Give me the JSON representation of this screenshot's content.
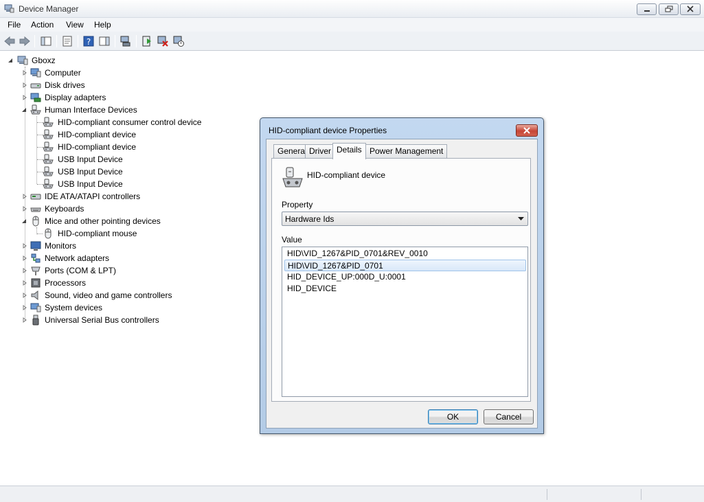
{
  "window": {
    "title": "Device Manager",
    "icon": "device-manager-icon"
  },
  "menu": [
    "File",
    "Action",
    "View",
    "Help"
  ],
  "toolbar": {
    "icons": [
      "back-arrow-icon",
      "forward-arrow-icon",
      "console-tree-icon",
      "properties-icon",
      "help-icon",
      "action-pane-icon",
      "update-driver-icon",
      "scan-hardware-icon",
      "uninstall-icon",
      "disable-icon"
    ]
  },
  "tree": {
    "root": "Gboxz",
    "categories": [
      {
        "label": "Computer",
        "icon": "computer-icon",
        "expanded": false
      },
      {
        "label": "Disk drives",
        "icon": "disk-drive-icon",
        "expanded": false
      },
      {
        "label": "Display adapters",
        "icon": "display-adapter-icon",
        "expanded": false
      },
      {
        "label": "Human Interface Devices",
        "icon": "hid-icon",
        "expanded": true,
        "children": [
          "HID-compliant consumer control device",
          "HID-compliant device",
          "HID-compliant device",
          "USB Input Device",
          "USB Input Device",
          "USB Input Device"
        ]
      },
      {
        "label": "IDE ATA/ATAPI controllers",
        "icon": "ide-controller-icon",
        "expanded": false
      },
      {
        "label": "Keyboards",
        "icon": "keyboard-icon",
        "expanded": false
      },
      {
        "label": "Mice and other pointing devices",
        "icon": "mouse-icon",
        "expanded": true,
        "children": [
          "HID-compliant mouse"
        ]
      },
      {
        "label": "Monitors",
        "icon": "monitor-icon",
        "expanded": false
      },
      {
        "label": "Network adapters",
        "icon": "network-adapter-icon",
        "expanded": false
      },
      {
        "label": "Ports (COM & LPT)",
        "icon": "port-icon",
        "expanded": false
      },
      {
        "label": "Processors",
        "icon": "processor-icon",
        "expanded": false
      },
      {
        "label": "Sound, video and game controllers",
        "icon": "sound-icon",
        "expanded": false
      },
      {
        "label": "System devices",
        "icon": "system-device-icon",
        "expanded": false
      },
      {
        "label": "Universal Serial Bus controllers",
        "icon": "usb-icon",
        "expanded": false
      }
    ]
  },
  "dialog": {
    "title": "HID-compliant device Properties",
    "tabs": [
      "General",
      "Driver",
      "Details",
      "Power Management"
    ],
    "active_tab": "Details",
    "device_name": "HID-compliant device",
    "property_label": "Property",
    "property_value": "Hardware Ids",
    "value_label": "Value",
    "values": [
      "HID\\VID_1267&PID_0701&REV_0010",
      "HID\\VID_1267&PID_0701",
      "HID_DEVICE_UP:000D_U:0001",
      "HID_DEVICE"
    ],
    "selected_value_index": 1,
    "ok_label": "OK",
    "cancel_label": "Cancel"
  },
  "colors": {
    "dialog_frame": "#b3cbe6",
    "selection": "#d9e8f9",
    "close_button": "#c64536"
  }
}
